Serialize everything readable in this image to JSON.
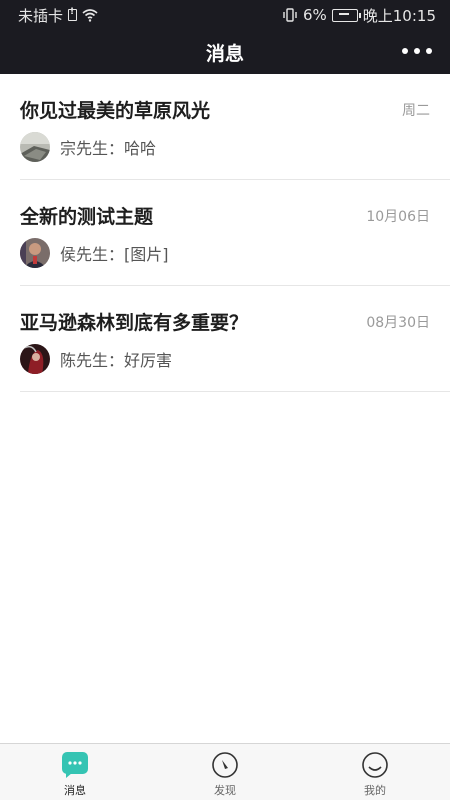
{
  "status_bar": {
    "carrier": "未插卡",
    "battery_percent": "6%",
    "time": "晚上10:15"
  },
  "header": {
    "title": "消息"
  },
  "messages": [
    {
      "title": "你见过最美的草原风光",
      "date": "周二",
      "sender": "宗先生：哈哈"
    },
    {
      "title": "全新的测试主题",
      "date": "10月06日",
      "sender": "侯先生：[图片]"
    },
    {
      "title": "亚马逊森林到底有多重要？",
      "date": "08月30日",
      "sender": "陈先生：好厉害"
    }
  ],
  "tabs": [
    {
      "label": "消息",
      "icon": "chat-icon",
      "active": true
    },
    {
      "label": "发现",
      "icon": "compass-icon",
      "active": false
    },
    {
      "label": "我的",
      "icon": "smile-icon",
      "active": false
    }
  ],
  "colors": {
    "header_bg": "#1b1b21",
    "accent": "#35c4b3"
  }
}
